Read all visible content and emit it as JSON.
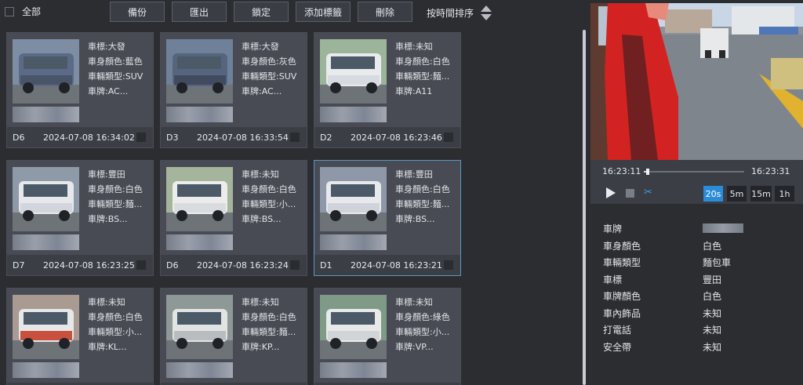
{
  "toolbar": {
    "select_all_label": "全部",
    "buttons": [
      "備份",
      "匯出",
      "鎖定",
      "添加標籤",
      "刪除"
    ],
    "sort_label": "按時間排序"
  },
  "field_labels": {
    "brand": "車標:",
    "body_color": "車身顏色:",
    "vehicle_type": "車輛類型:",
    "plate": "車牌:"
  },
  "cards": [
    {
      "brand": "大發",
      "body_color": "藍色",
      "vehicle_type": "SUV",
      "plate": "AC...",
      "camera": "D6",
      "time": "2024-07-08 16:34:02",
      "selected": false
    },
    {
      "brand": "大發",
      "body_color": "灰色",
      "vehicle_type": "SUV",
      "plate": "AC...",
      "camera": "D3",
      "time": "2024-07-08 16:33:54",
      "selected": false
    },
    {
      "brand": "未知",
      "body_color": "白色",
      "vehicle_type": "麵...",
      "plate": "A11",
      "camera": "D2",
      "time": "2024-07-08 16:23:46",
      "selected": false
    },
    {
      "brand": "豐田",
      "body_color": "白色",
      "vehicle_type": "麵...",
      "plate": "BS...",
      "camera": "D7",
      "time": "2024-07-08 16:23:25",
      "selected": false
    },
    {
      "brand": "未知",
      "body_color": "白色",
      "vehicle_type": "小...",
      "plate": "BS...",
      "camera": "D6",
      "time": "2024-07-08 16:23:24",
      "selected": false
    },
    {
      "brand": "豐田",
      "body_color": "白色",
      "vehicle_type": "麵...",
      "plate": "BS...",
      "camera": "D1",
      "time": "2024-07-08 16:23:21",
      "selected": true
    },
    {
      "brand": "未知",
      "body_color": "白色",
      "vehicle_type": "小...",
      "plate": "KL...",
      "camera": "",
      "time": "",
      "selected": false
    },
    {
      "brand": "未知",
      "body_color": "白色",
      "vehicle_type": "麵...",
      "plate": "KP...",
      "camera": "",
      "time": "",
      "selected": false
    },
    {
      "brand": "未知",
      "body_color": "綠色",
      "vehicle_type": "小...",
      "plate": "VP...",
      "camera": "",
      "time": "",
      "selected": false
    }
  ],
  "player": {
    "start_time": "16:23:11",
    "end_time": "16:23:31",
    "progress": 0.02,
    "durations": [
      "20s",
      "5m",
      "15m",
      "1h"
    ],
    "active_duration": "20s"
  },
  "details": [
    {
      "key": "車牌",
      "value": ""
    },
    {
      "key": "車身顏色",
      "value": "白色"
    },
    {
      "key": "車輛類型",
      "value": "麵包車"
    },
    {
      "key": "車標",
      "value": "豐田"
    },
    {
      "key": "車牌顏色",
      "value": "白色"
    },
    {
      "key": "車內飾品",
      "value": "未知"
    },
    {
      "key": "打電話",
      "value": "未知"
    },
    {
      "key": "安全帶",
      "value": "未知"
    }
  ],
  "colors": {
    "accent": "#2a8cd6",
    "selected_border": "#5b95c4"
  }
}
